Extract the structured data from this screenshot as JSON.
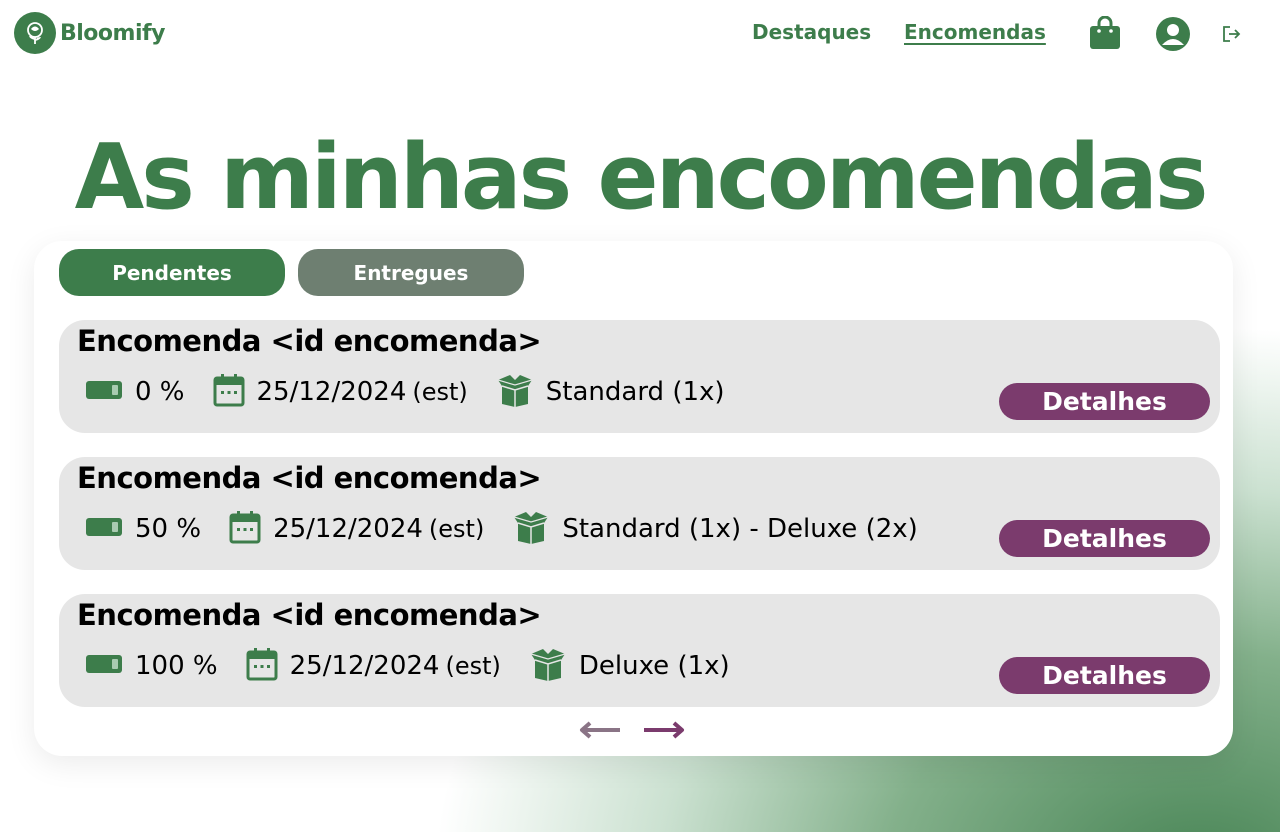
{
  "brand": {
    "name": "Bloomify"
  },
  "nav": {
    "links": [
      {
        "label": "Destaques",
        "active": false
      },
      {
        "label": "Encomendas",
        "active": true
      }
    ],
    "icons": [
      "shopping-bag-icon",
      "user-account-icon",
      "logout-icon"
    ]
  },
  "page": {
    "title": "As minhas encomendas"
  },
  "tabs": [
    {
      "label": "Pendentes",
      "active": true
    },
    {
      "label": "Entregues",
      "active": false
    }
  ],
  "orders": [
    {
      "title": "Encomenda <id encomenda>",
      "progress": "0 %",
      "date": "25/12/2024",
      "date_note": "(est)",
      "items": "Standard (1x)",
      "button": "Detalhes"
    },
    {
      "title": "Encomenda <id encomenda>",
      "progress": "50 %",
      "date": "25/12/2024",
      "date_note": "(est)",
      "items": "Standard (1x) - Deluxe (2x)",
      "button": "Detalhes"
    },
    {
      "title": "Encomenda <id encomenda>",
      "progress": "100 %",
      "date": "25/12/2024",
      "date_note": "(est)",
      "items": "Deluxe (1x)",
      "button": "Detalhes"
    }
  ],
  "colors": {
    "primary_green": "#3d7d4b",
    "muted_green": "#6e7f71",
    "accent_purple": "#7b3b6d",
    "card_gray": "#e6e6e6",
    "pager_prev": "#8a7486"
  }
}
